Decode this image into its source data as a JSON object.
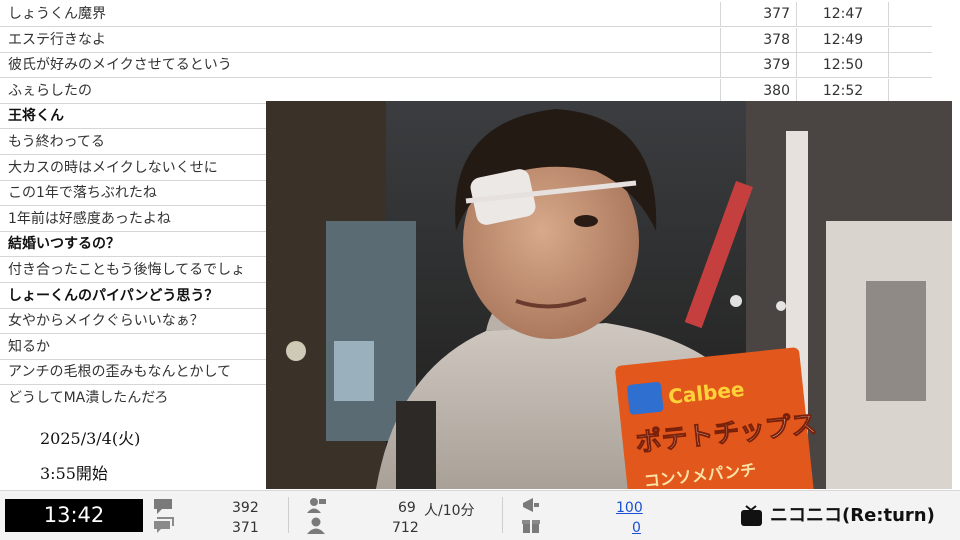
{
  "comments": [
    {
      "text": "しょうくん魔界",
      "no": "377",
      "time": "12:47",
      "bold": false
    },
    {
      "text": "エステ行きなよ",
      "no": "378",
      "time": "12:49",
      "bold": false
    },
    {
      "text": "彼氏が好みのメイクさせてるという",
      "no": "379",
      "time": "12:50",
      "bold": false
    },
    {
      "text": "ふぇらしたの",
      "no": "380",
      "time": "12:52",
      "bold": false
    },
    {
      "text": "王将くん",
      "no": "",
      "time": "",
      "bold": true
    },
    {
      "text": "もう終わってる",
      "no": "",
      "time": "",
      "bold": false
    },
    {
      "text": "大カスの時はメイクしないくせに",
      "no": "",
      "time": "",
      "bold": false
    },
    {
      "text": "この1年で落ちぶれたね",
      "no": "",
      "time": "",
      "bold": false
    },
    {
      "text": "1年前は好感度あったよね",
      "no": "",
      "time": "",
      "bold": false
    },
    {
      "text": "結婚いつするの？",
      "no": "",
      "time": "",
      "bold": true
    },
    {
      "text": "付き合ったこともう後悔してるでしょ",
      "no": "",
      "time": "",
      "bold": false
    },
    {
      "text": "しょーくんのパイパンどう思う？",
      "no": "",
      "time": "",
      "bold": true
    },
    {
      "text": "女やからメイクぐらいいなぁ？",
      "no": "",
      "time": "",
      "bold": false
    },
    {
      "text": "知るか",
      "no": "",
      "time": "",
      "bold": false
    },
    {
      "text": "アンチの毛根の歪みもなんとかして",
      "no": "",
      "time": "",
      "bold": false
    },
    {
      "text": "どうしてMA潰したんだろ",
      "no": "",
      "time": "",
      "bold": false
    }
  ],
  "overlay": {
    "date": "2025/3/4(火)",
    "start": "3:55開始"
  },
  "video": {
    "bag_brand": "Calbee",
    "bag_product": "ポテトチップス",
    "bag_flavor": "コンソメパンチ"
  },
  "status": {
    "timer": "13:42",
    "comments_total": "392",
    "comments_sub": "371",
    "viewers_rate": "69",
    "viewers_unit": "人/10分",
    "viewers_total": "712",
    "ads": "100",
    "gifts": "0",
    "brand": "ニコニコ(Re:turn)"
  },
  "colors": {
    "link": "#1b4fd8",
    "timer_bg": "#000000",
    "bag_orange": "#e2571b"
  }
}
